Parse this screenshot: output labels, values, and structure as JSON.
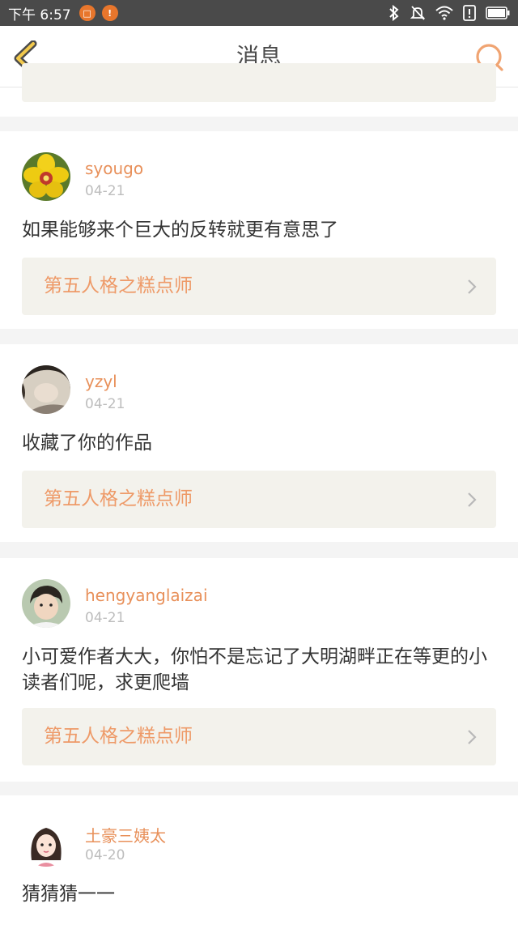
{
  "status_bar": {
    "time": "下午 6:57",
    "notif_icons": [
      "app-notification-icon",
      "alert-notification-icon"
    ],
    "right_icons": [
      "bluetooth-icon",
      "mute-icon",
      "wifi-icon",
      "sim-alert-icon",
      "battery-icon"
    ]
  },
  "header": {
    "title": "消息",
    "accent_color": "#e8905a"
  },
  "messages": [
    {
      "username": "syougo",
      "date": "04-21",
      "text": "如果能够来个巨大的反转就更有意思了",
      "work_title": "第五人格之糕点师"
    },
    {
      "username": "yzyl",
      "date": "04-21",
      "text": "收藏了你的作品",
      "work_title": "第五人格之糕点师"
    },
    {
      "username": "hengyanglaizai",
      "date": "04-21",
      "text": "小可爱作者大大，你怕不是忘记了大明湖畔正在等更的小读者们呢，求更爬墙",
      "work_title": "第五人格之糕点师"
    },
    {
      "username": "土豪三姨太",
      "date": "04-20",
      "text": "猜猜猜一一"
    }
  ]
}
